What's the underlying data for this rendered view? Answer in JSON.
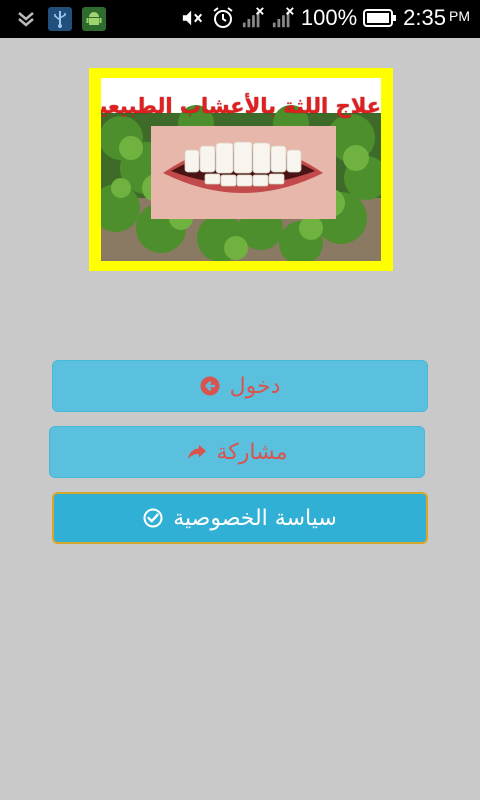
{
  "status_bar": {
    "battery_percent": "100%",
    "time": "2:35",
    "ampm": "PM",
    "icons": [
      "notification-expand-icon",
      "usb-icon",
      "android-debug-icon",
      "mute-icon",
      "alarm-icon",
      "no-signal-icon",
      "no-signal-icon",
      "battery-icon"
    ]
  },
  "banner": {
    "title": "علاج اللثة بالأعشاب الطبيعية"
  },
  "buttons": {
    "login": {
      "label": "دخول",
      "icon": "arrow-circle-left-icon"
    },
    "share": {
      "label": "مشاركة",
      "icon": "share-arrow-icon"
    },
    "privacy": {
      "label": "سياسة الخصوصية",
      "icon": "check-circle-icon"
    }
  },
  "colors": {
    "background": "#c9c9c9",
    "button_info": "#5bc0de",
    "button_active": "#31b0d5",
    "button_text_danger": "#d9534f",
    "banner_border": "#ffff00",
    "banner_title": "#e02020"
  }
}
